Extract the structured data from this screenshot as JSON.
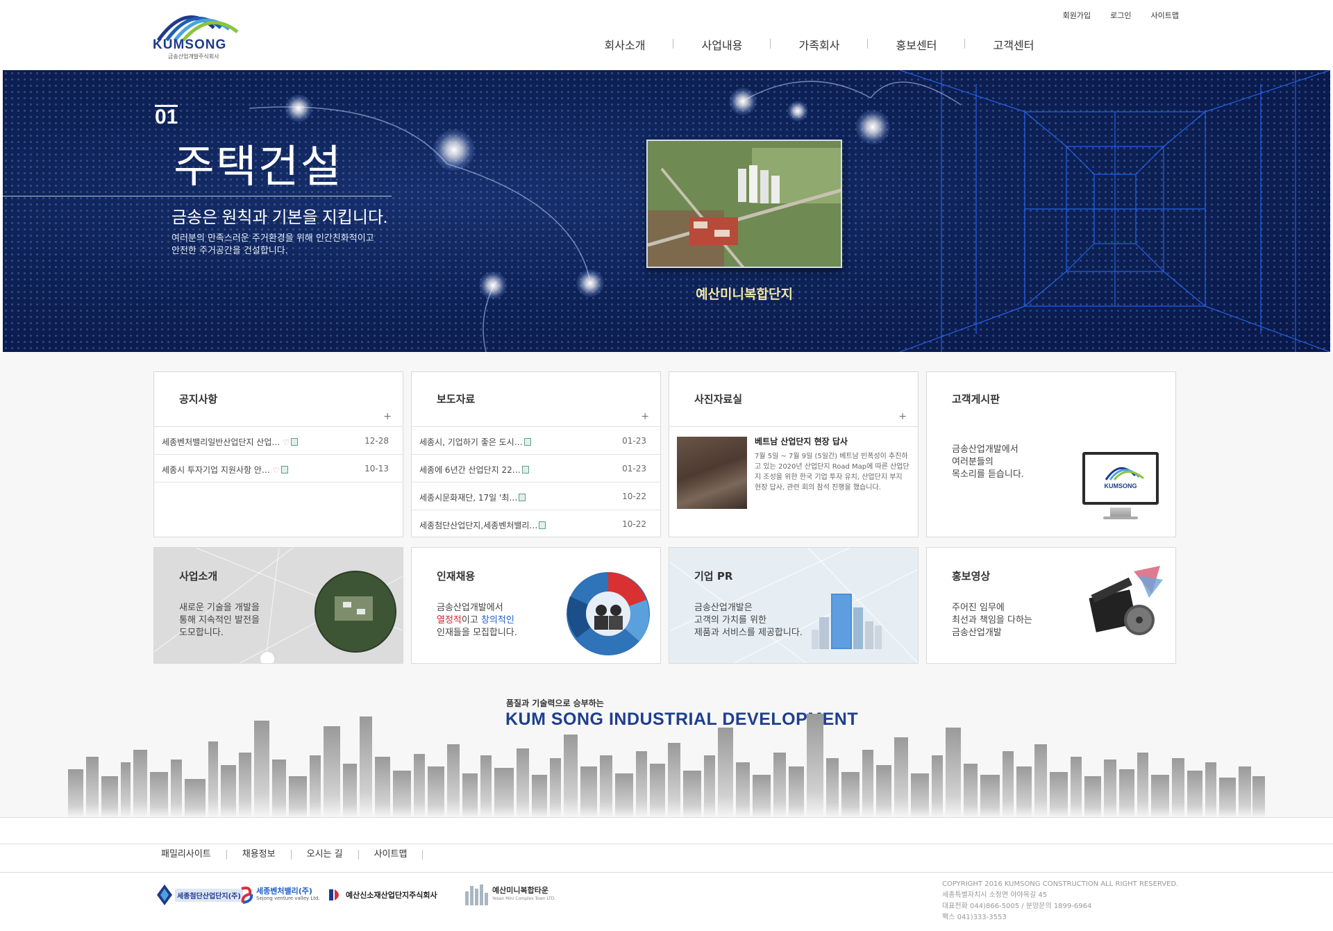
{
  "brand": {
    "name": "KUMSONG",
    "subtitle": "금송산업개발주식회사"
  },
  "util_links": [
    "회원가입",
    "로그인",
    "사이트맵"
  ],
  "nav": [
    "회사소개",
    "사업내용",
    "가족회사",
    "홍보센터",
    "고객센터"
  ],
  "hero": {
    "number": "01",
    "title": "주택건설",
    "subtitle": "금송은 원칙과 기본을 지킵니다.",
    "desc_1": "여러분의 만족스러운 주거환경을 위해 인간친화적이고",
    "desc_2": "안전한 주거공간을 건설합니다.",
    "photo_caption": "예산미니복합단지"
  },
  "notice": {
    "title": "공지사항",
    "items": [
      {
        "text": "세종벤처밸리일반산업단지 산업…",
        "date": "12-28"
      },
      {
        "text": "세종시 투자기업 지원사항 안…",
        "date": "10-13"
      }
    ]
  },
  "press": {
    "title": "보도자료",
    "items": [
      {
        "text": "세종시, 기업하기 좋은 도시…",
        "date": "01-23"
      },
      {
        "text": "세종에 6년간 산업단지 22…",
        "date": "01-23"
      },
      {
        "text": "세종시문화재단, 17일 '최…",
        "date": "10-22"
      },
      {
        "text": "세종첨단산업단지,세종벤처밸리…",
        "date": "10-22"
      }
    ]
  },
  "photos": {
    "title": "사진자료실",
    "headline": "베트남 산업단지 현장 답사",
    "desc": "7월 5일 ~ 7월 9일 (5일간) 베트남 빈폭성이 추진하고 있는 2020년 산업단지 Road Map에 따른 산업단지 조성을 위한 한국 기업 투자 유치, 산업단지 부지 현장 답사, 관련 회의 참석 진행을 했습니다."
  },
  "board": {
    "title": "고객게시판",
    "line1": "금송산업개발에서",
    "line2": "여러분들의",
    "line3": "목소리를 듣습니다."
  },
  "biz": {
    "title": "사업소개",
    "line1": "새로운 기술을 개발을",
    "line2": "통해 지속적인 발전을",
    "line3": "도모합니다."
  },
  "recruit": {
    "title": "인재채용",
    "line1": "금송산업개발에서",
    "hl1": "열정적",
    "mid": "이고 ",
    "hl2": "창의적인",
    "line3": "인재들을 모집합니다."
  },
  "pr": {
    "title": "기업 PR",
    "line1": "금송산업개발은",
    "line2": "고객의 가치를 위한",
    "line3": "제품과 서비스를 제공합니다."
  },
  "video": {
    "title": "홍보영상",
    "line1": "주어진 임무에",
    "line2": "최선과 책임을 다하는",
    "line3": "금송산업개발"
  },
  "banner": {
    "small": "품질과 기술력으로 승부하는",
    "big": "KUM SONG INDUSTRIAL DEVELOPMENT"
  },
  "footer_links": [
    "패밀리사이트",
    "채용정보",
    "오시는 길",
    "사이트맵"
  ],
  "family": [
    {
      "name": "세종첨단산업단지(주)"
    },
    {
      "name": "세종벤처밸리(주)",
      "sub": "Sejong venture valley Ltd."
    },
    {
      "name": "예산신소재산업단지주식회사"
    },
    {
      "name": "예산미니복합타운",
      "sub": "Yesan Mini Complex Town LTD."
    }
  ],
  "copyright": {
    "line1": "COPYRIGHT 2016 KUMSONG CONSTRUCTION ALL RIGHT RESERVED.",
    "line2": "세종특별자치시 소정면 아야목길 45",
    "line3": "대표전화 044)866-5005 / 분양문의 1899-6964",
    "line4": "팩스 041)333-3553"
  },
  "colors": {
    "navy": "#0d2257",
    "brand_blue": "#1e3a8a",
    "banner_blue": "#1d3f8f",
    "caption_yellow": "#f2e7a4"
  }
}
